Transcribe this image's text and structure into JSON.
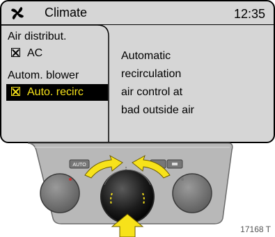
{
  "display": {
    "title": "Climate",
    "clock": "12:35",
    "menu": {
      "air_distribution": "Air distribut.",
      "ac": "AC",
      "auto_blower": "Autom. blower",
      "auto_recirc": "Auto. recirc"
    },
    "info_lines": [
      "Automatic",
      "recirculation",
      "air control at",
      "bad outside air"
    ]
  },
  "panel": {
    "auto_button_label": "AUTO"
  },
  "figure_id": "17168 T",
  "colors": {
    "screen_bg": "#d6d6d6",
    "highlight_bg": "#000000",
    "highlight_text": "#f7e21a",
    "arrow_yellow": "#f7e21a"
  },
  "icons": [
    "fan-icon",
    "checkbox-icon",
    "rotate-arrow-icon",
    "press-arrow-icon"
  ]
}
